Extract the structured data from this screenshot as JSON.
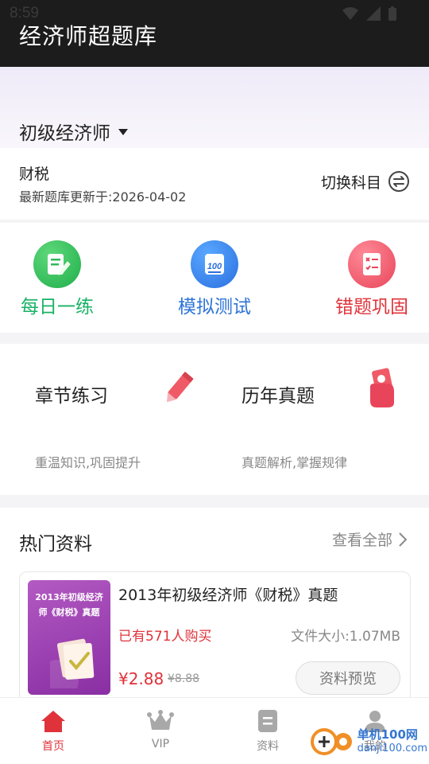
{
  "status_bar": {
    "time": "8:59"
  },
  "app": {
    "title": "经济师超题库"
  },
  "header": {
    "level": "初级经济师"
  },
  "subject": {
    "name": "财税",
    "update_text": "最新题库更新于:2026-04-02",
    "switch_label": "切换科目"
  },
  "quick_actions": [
    {
      "label": "每日一练",
      "color": "#19b266",
      "icon": "daily-practice-icon"
    },
    {
      "label": "模拟测试",
      "color": "#2e74d8",
      "icon": "mock-test-icon"
    },
    {
      "label": "错题巩固",
      "color": "#e0323a",
      "icon": "mistakes-review-icon"
    }
  ],
  "practice": [
    {
      "title": "章节练习",
      "subtitle": "重温知识,巩固提升",
      "icon": "pencil-icon"
    },
    {
      "title": "历年真题",
      "subtitle": "真题解析,掌握规律",
      "icon": "hand-money-icon"
    }
  ],
  "hot": {
    "title": "热门资料",
    "view_all": "查看全部",
    "item": {
      "cover_line1": "2013年初级经济",
      "cover_line2": "师《财税》真题",
      "title": "2013年初级经济师《财税》真题",
      "bought": "已有571人购买",
      "file_size": "文件大小:1.07MB",
      "price": "¥2.88",
      "old_price": "¥8.88",
      "preview_label": "资料预览"
    }
  },
  "nav": [
    {
      "label": "首页",
      "icon": "home-icon",
      "active": true
    },
    {
      "label": "VIP",
      "icon": "crown-icon",
      "active": false
    },
    {
      "label": "资料",
      "icon": "document-icon",
      "active": false
    },
    {
      "label": "我的",
      "icon": "user-icon",
      "active": false
    }
  ],
  "watermark": {
    "line1": "单机100网",
    "line2": "danji100.com"
  },
  "colors": {
    "accent_red": "#e0323a",
    "green": "#19b266",
    "blue": "#2e74d8",
    "appbar": "#1c1c1c"
  }
}
